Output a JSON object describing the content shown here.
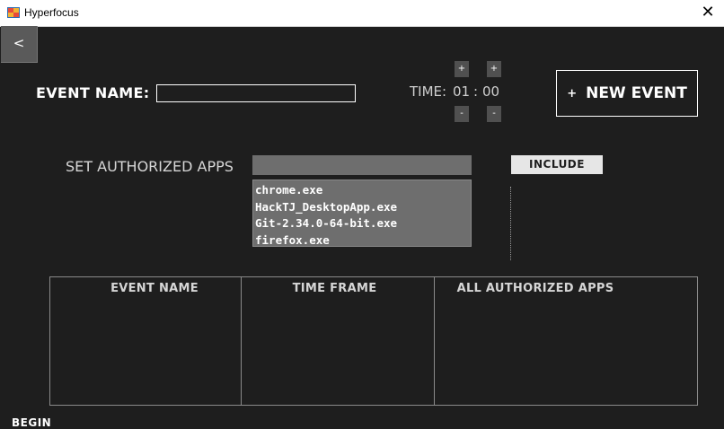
{
  "window": {
    "title": "Hyperfocus",
    "close_glyph": "✕",
    "icon": "app-icon"
  },
  "nav": {
    "back_label": "<"
  },
  "event": {
    "name_label": "EVENT NAME:",
    "name_value": ""
  },
  "time": {
    "label": "TIME:",
    "hours": "01",
    "separator": ":",
    "minutes": "00",
    "plus": "+",
    "minus": "-"
  },
  "new_event": {
    "plus": "+",
    "label": "NEW EVENT"
  },
  "apps": {
    "label": "SET AUTHORIZED APPS",
    "input_value": "",
    "include_label": "INCLUDE",
    "list": [
      "chrome.exe",
      "HackTJ_DesktopApp.exe",
      "Git-2.34.0-64-bit.exe",
      "firefox.exe"
    ]
  },
  "table": {
    "headers": [
      "EVENT NAME",
      "TIME FRAME",
      "ALL AUTHORIZED APPS"
    ]
  },
  "footer": {
    "begin_label": "BEGIN"
  },
  "colors": {
    "background": "#1e1e1e",
    "input_gray": "#6e6e6e",
    "button_light": "#e6e6e6",
    "border": "#8a8a8a"
  }
}
